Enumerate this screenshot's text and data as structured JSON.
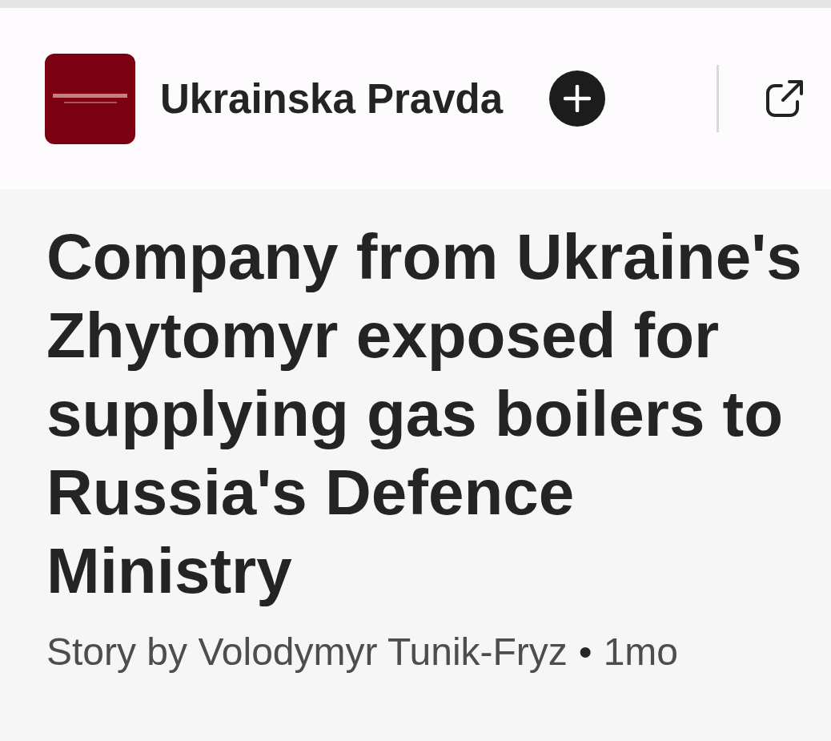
{
  "publisher": {
    "name": "Ukrainska Pravda"
  },
  "article": {
    "headline": "Company from Ukraine's Zhytomyr exposed for supplying gas boilers to Russia's Defence Ministry",
    "byline": "Story by Volodymyr Tunik-Fryz",
    "separator": "•",
    "age": "1mo"
  }
}
